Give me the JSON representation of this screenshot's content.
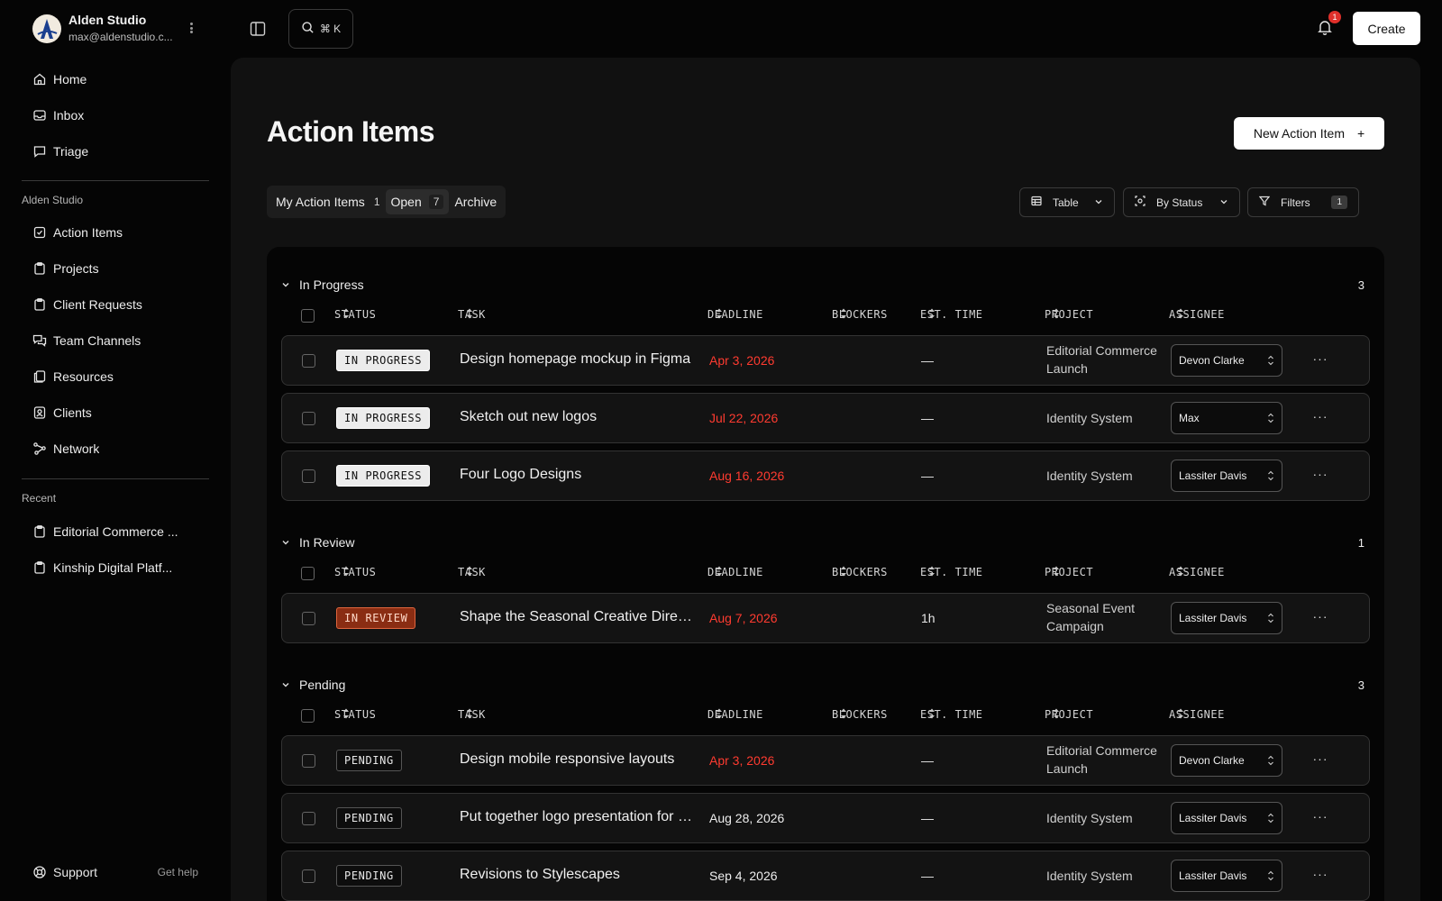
{
  "workspace": {
    "name": "Alden Studio",
    "email": "max@aldenstudio.c..."
  },
  "nav_primary": [
    {
      "label": "Home",
      "icon": "home-icon"
    },
    {
      "label": "Inbox",
      "icon": "inbox-icon"
    },
    {
      "label": "Triage",
      "icon": "chat-icon"
    }
  ],
  "section_studio": {
    "heading": "Alden Studio",
    "items": [
      {
        "label": "Action Items",
        "icon": "checklist-icon"
      },
      {
        "label": "Projects",
        "icon": "clipboard-icon"
      },
      {
        "label": "Client Requests",
        "icon": "clipboard-icon"
      },
      {
        "label": "Team Channels",
        "icon": "chat-icon"
      },
      {
        "label": "Resources",
        "icon": "documents-icon"
      },
      {
        "label": "Clients",
        "icon": "contact-icon"
      },
      {
        "label": "Network",
        "icon": "network-icon"
      }
    ]
  },
  "section_recent": {
    "heading": "Recent",
    "items": [
      {
        "label": "Editorial Commerce ...",
        "icon": "clipboard-icon"
      },
      {
        "label": "Kinship Digital Platf...",
        "icon": "clipboard-icon"
      }
    ]
  },
  "support": {
    "label": "Support",
    "link": "Get help"
  },
  "topbar": {
    "search_shortcut": "⌘ K",
    "notification_count": "1",
    "create_label": "Create"
  },
  "page": {
    "title": "Action Items",
    "new_button": "New Action Item",
    "new_button_icon": "+"
  },
  "tabs": [
    {
      "label": "My Action Items",
      "count": "1"
    },
    {
      "label": "Open",
      "count": "7"
    },
    {
      "label": "Archive",
      "count": ""
    }
  ],
  "toolbar": {
    "view_label": "Table",
    "group_label": "By Status",
    "filters_label": "Filters",
    "filters_count": "1"
  },
  "columns": [
    "STATUS",
    "TASK",
    "DEADLINE",
    "BLOCKERS",
    "EST. TIME",
    "PROJECT",
    "ASSIGNEE"
  ],
  "groups": [
    {
      "name": "In Progress",
      "count": "3",
      "rows": [
        {
          "status": "IN PROGRESS",
          "task": "Design homepage mockup in Figma",
          "deadline": "Apr 3, 2026",
          "late": true,
          "est": "—",
          "project": "Editorial Commerce Launch",
          "assignee": "Devon Clarke"
        },
        {
          "status": "IN PROGRESS",
          "task": "Sketch out new logos",
          "deadline": "Jul 22, 2026",
          "late": true,
          "est": "—",
          "project": "Identity System",
          "assignee": "Max"
        },
        {
          "status": "IN PROGRESS",
          "task": "Four Logo Designs",
          "deadline": "Aug 16, 2026",
          "late": true,
          "est": "—",
          "project": "Identity System",
          "assignee": "Lassiter Davis"
        }
      ]
    },
    {
      "name": "In Review",
      "count": "1",
      "rows": [
        {
          "status": "IN REVIEW",
          "task": "Shape the Seasonal Creative Direction",
          "deadline": "Aug 7, 2026",
          "late": true,
          "est": "1h",
          "project": "Seasonal Event Campaign",
          "assignee": "Lassiter Davis"
        }
      ]
    },
    {
      "name": "Pending",
      "count": "3",
      "rows": [
        {
          "status": "PENDING",
          "task": "Design mobile responsive layouts",
          "deadline": "Apr 3, 2026",
          "late": true,
          "est": "—",
          "project": "Editorial Commerce Launch",
          "assignee": "Devon Clarke"
        },
        {
          "status": "PENDING",
          "task": "Put together logo presentation for review",
          "deadline": "Aug 28, 2026",
          "late": false,
          "est": "—",
          "project": "Identity System",
          "assignee": "Lassiter Davis"
        },
        {
          "status": "PENDING",
          "task": "Revisions to Stylescapes",
          "deadline": "Sep 4, 2026",
          "late": false,
          "est": "—",
          "project": "Identity System",
          "assignee": "Lassiter Davis"
        }
      ]
    }
  ],
  "colors": {
    "late": "#ff3b30",
    "review_badge": "#8a2d13",
    "accent_white": "#ffffff"
  }
}
